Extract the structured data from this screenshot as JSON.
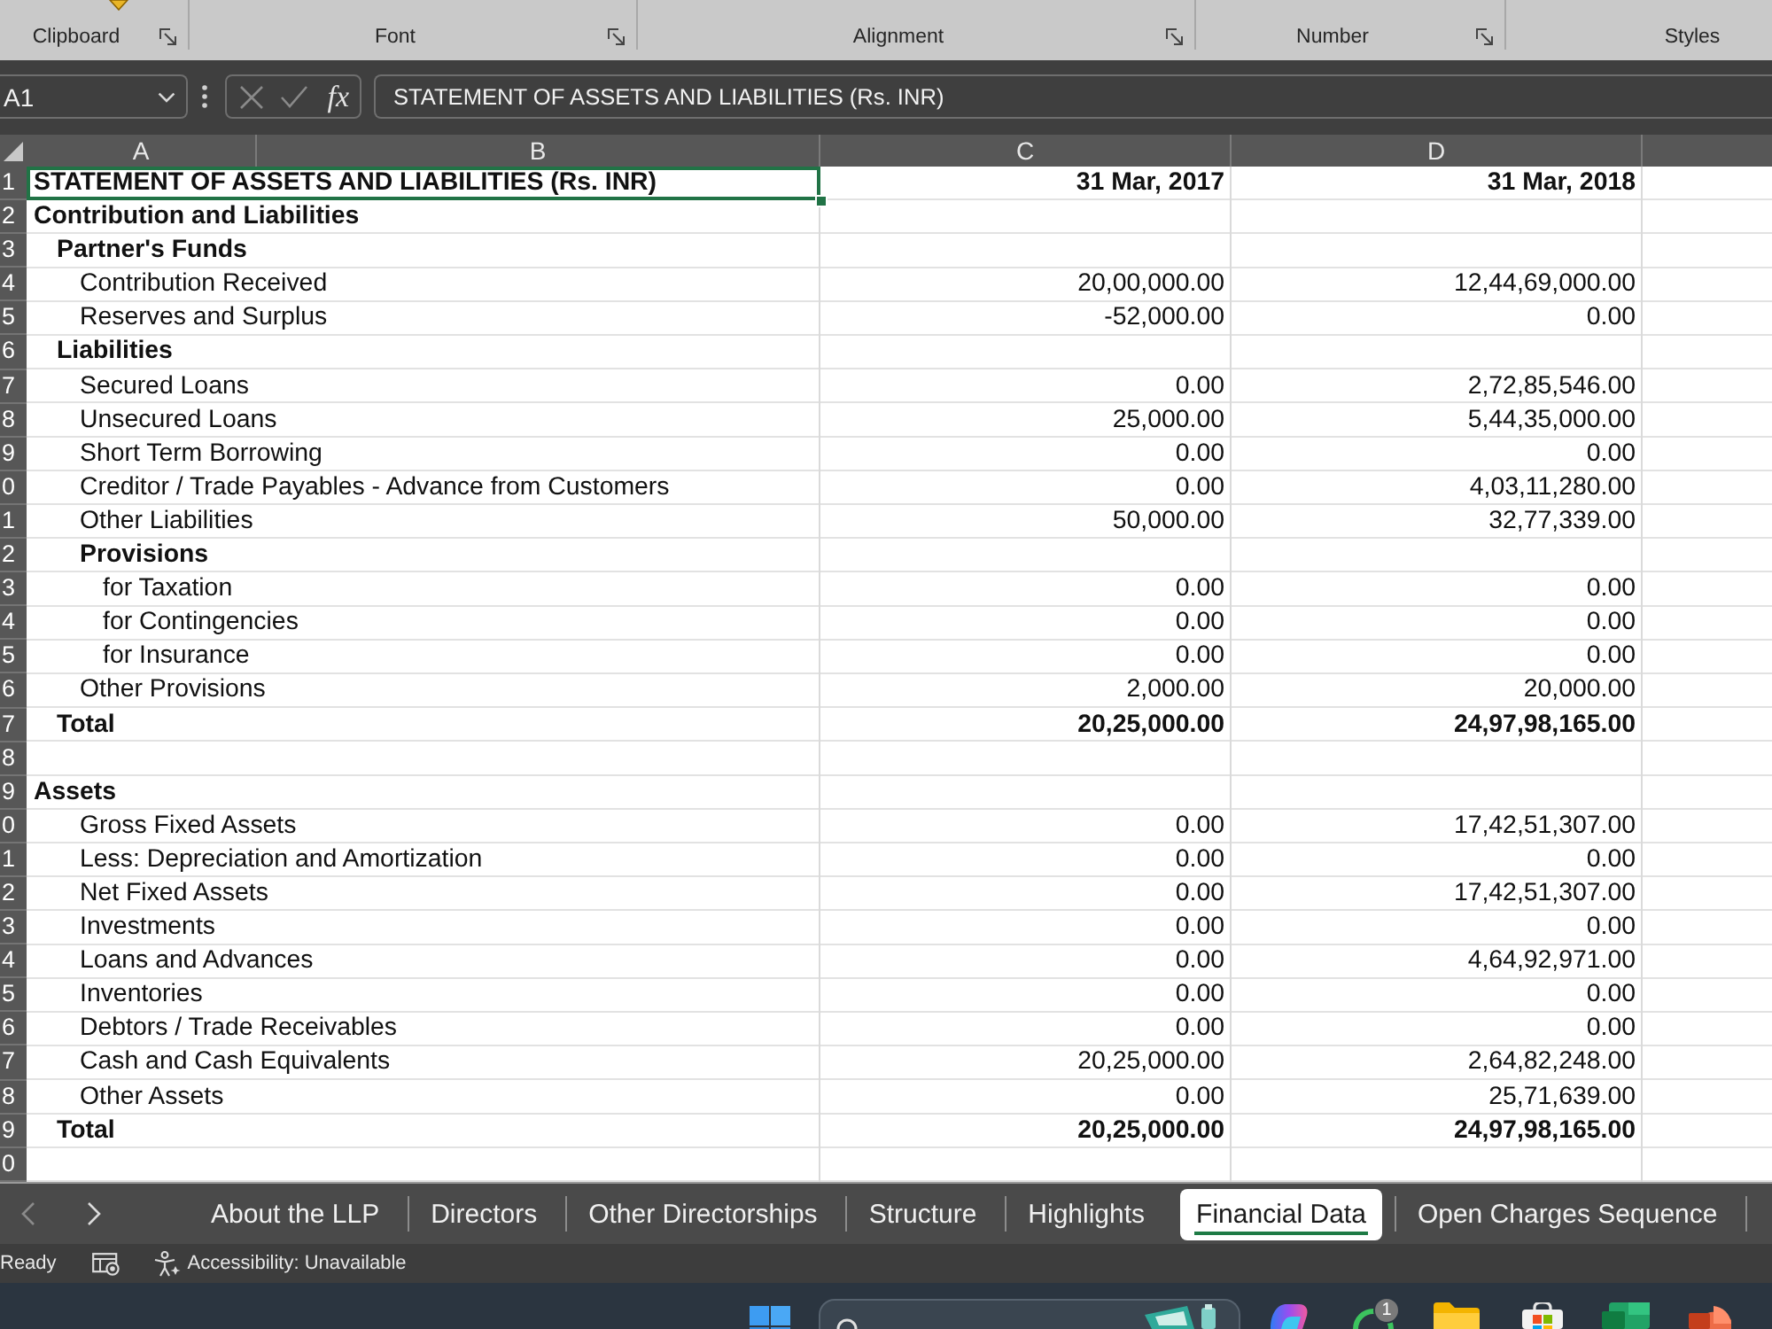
{
  "ribbon": {
    "groups": [
      {
        "label": "Clipboard",
        "launcher": true
      },
      {
        "label": "Font",
        "launcher": true
      },
      {
        "label": "Alignment",
        "launcher": true
      },
      {
        "label": "Number",
        "launcher": true
      },
      {
        "label": "Styles",
        "launcher": false
      }
    ]
  },
  "formula_bar": {
    "name_box": "A1",
    "function_label": "fx",
    "formula": "STATEMENT OF ASSETS AND LIABILITIES (Rs. INR)"
  },
  "sheet": {
    "columns": [
      "A",
      "B",
      "C",
      "D"
    ],
    "rows": [
      {
        "number": "1",
        "kind": "title",
        "label": "STATEMENT OF ASSETS AND LIABILITIES (Rs. INR)",
        "values": [
          "31 Mar, 2017",
          "31 Mar, 2018"
        ],
        "selected": true
      },
      {
        "number": "2",
        "kind": "section",
        "label": "Contribution and Liabilities",
        "selected": false
      },
      {
        "number": "3",
        "kind": "group",
        "label": "Partner's Funds",
        "selected": false
      },
      {
        "number": "4",
        "kind": "item",
        "label": "Contribution Received",
        "values": [
          "20,00,000.00",
          "12,44,69,000.00"
        ],
        "selected": false
      },
      {
        "number": "5",
        "kind": "item",
        "label": "Reserves and Surplus",
        "values": [
          "-52,000.00",
          "0.00"
        ],
        "selected": false
      },
      {
        "number": "6",
        "kind": "group",
        "label": "Liabilities",
        "selected": false
      },
      {
        "number": "7",
        "kind": "item",
        "label": "Secured Loans",
        "values": [
          "0.00",
          "2,72,85,546.00"
        ],
        "selected": false
      },
      {
        "number": "8",
        "kind": "item",
        "label": "Unsecured Loans",
        "values": [
          "25,000.00",
          "5,44,35,000.00"
        ],
        "selected": false
      },
      {
        "number": "9",
        "kind": "item",
        "label": "Short Term Borrowing",
        "values": [
          "0.00",
          "0.00"
        ],
        "selected": false
      },
      {
        "number": "0",
        "kind": "item",
        "label": "Creditor / Trade Payables - Advance from Customers",
        "values": [
          "0.00",
          "4,03,11,280.00"
        ],
        "selected": false
      },
      {
        "number": "1",
        "kind": "item",
        "label": "Other Liabilities",
        "values": [
          "50,000.00",
          "32,77,339.00"
        ],
        "selected": false
      },
      {
        "number": "2",
        "kind": "subgroup",
        "label": "Provisions",
        "selected": false
      },
      {
        "number": "3",
        "kind": "subitem",
        "label": "for Taxation",
        "values": [
          "0.00",
          "0.00"
        ],
        "selected": false
      },
      {
        "number": "4",
        "kind": "subitem",
        "label": "for Contingencies",
        "values": [
          "0.00",
          "0.00"
        ],
        "selected": false
      },
      {
        "number": "5",
        "kind": "subitem",
        "label": "for Insurance",
        "values": [
          "0.00",
          "0.00"
        ],
        "selected": false
      },
      {
        "number": "6",
        "kind": "item",
        "label": "Other Provisions",
        "values": [
          "2,000.00",
          "20,000.00"
        ],
        "selected": false
      },
      {
        "number": "7",
        "kind": "total",
        "label": "Total",
        "values": [
          "20,25,000.00",
          "24,97,98,165.00"
        ],
        "selected": false
      },
      {
        "number": "8",
        "kind": "blank",
        "selected": false
      },
      {
        "number": "9",
        "kind": "section",
        "label": "Assets",
        "selected": false
      },
      {
        "number": "0",
        "kind": "item",
        "label": "Gross Fixed Assets",
        "values": [
          "0.00",
          "17,42,51,307.00"
        ],
        "selected": false
      },
      {
        "number": "1",
        "kind": "item",
        "label": "Less: Depreciation and Amortization",
        "values": [
          "0.00",
          "0.00"
        ],
        "selected": false
      },
      {
        "number": "2",
        "kind": "item",
        "label": "Net Fixed Assets",
        "values": [
          "0.00",
          "17,42,51,307.00"
        ],
        "selected": false
      },
      {
        "number": "3",
        "kind": "item",
        "label": "Investments",
        "values": [
          "0.00",
          "0.00"
        ],
        "selected": false
      },
      {
        "number": "4",
        "kind": "item",
        "label": "Loans and Advances",
        "values": [
          "0.00",
          "4,64,92,971.00"
        ],
        "selected": false
      },
      {
        "number": "5",
        "kind": "item",
        "label": "Inventories",
        "values": [
          "0.00",
          "0.00"
        ],
        "selected": false
      },
      {
        "number": "6",
        "kind": "item",
        "label": "Debtors / Trade Receivables",
        "values": [
          "0.00",
          "0.00"
        ],
        "selected": false
      },
      {
        "number": "7",
        "kind": "item",
        "label": "Cash and Cash Equivalents",
        "values": [
          "20,25,000.00",
          "2,64,82,248.00"
        ],
        "selected": false
      },
      {
        "number": "8",
        "kind": "item",
        "label": "Other Assets",
        "values": [
          "0.00",
          "25,71,639.00"
        ],
        "selected": false
      },
      {
        "number": "9",
        "kind": "total",
        "label": "Total",
        "values": [
          "20,25,000.00",
          "24,97,98,165.00"
        ],
        "selected": false
      },
      {
        "number": "0",
        "kind": "blank",
        "selected": false
      }
    ]
  },
  "tabs": {
    "scroll_buttons": [
      {
        "kind": "previous",
        "disabled": true
      },
      {
        "kind": "next",
        "disabled": false
      }
    ],
    "sheets": [
      {
        "label": "About the LLP",
        "selected": false
      },
      {
        "label": "Directors",
        "selected": false
      },
      {
        "label": "Other Directorships",
        "selected": false
      },
      {
        "label": "Structure",
        "selected": false
      },
      {
        "label": "Highlights",
        "selected": false
      },
      {
        "label": "Financial Data",
        "selected": true
      },
      {
        "label": "Open Charges Sequence",
        "selected": false
      }
    ]
  },
  "status_bar": {
    "mode": "Ready",
    "accessibility": "Accessibility: Unavailable"
  },
  "taskbar": {
    "badge": "1"
  }
}
